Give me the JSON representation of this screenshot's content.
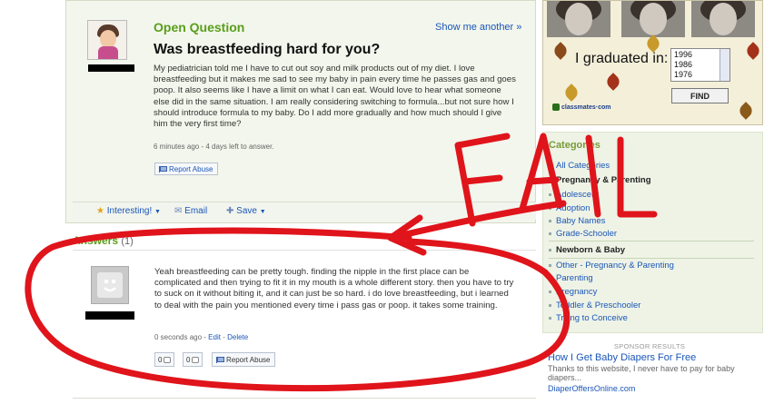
{
  "question": {
    "label": "Open Question",
    "show_another": "Show me another »",
    "title": "Was breastfeeding hard for you?",
    "body": "My pediatrician told me I have to cut out soy and milk products out of my diet. I love breastfeeding but it makes me sad to see my baby in pain every time he passes gas and goes poop. It also seems like I have a limit on what I can eat. Would love to hear what someone else did in the same situation. I am really considering switching to formula...but not sure how I should introduce formula to my baby. Do I add more gradually and how much should I give him the very first time?",
    "time": "6 minutes ago - 4 days left to answer.",
    "report_abuse": "Report Abuse"
  },
  "toolbar": {
    "interesting": "Interesting!",
    "email": "Email",
    "save": "Save"
  },
  "answers": {
    "heading": "Answers",
    "count": "(1)",
    "items": [
      {
        "body": "Yeah breastfeeding can be pretty tough. finding the nipple in the first place can be complicated and then trying to fit it in my mouth is a whole different story. then you have to try to suck on it without biting it, and it can just be so hard. i do love breastfeeding, but i learned to deal with the pain you mentioned every time i pass gas or poop. it takes some training.",
        "time": "0 seconds ago",
        "edit": "Edit",
        "delete": "Delete",
        "thumbs_up": "0",
        "thumbs_down": "0",
        "report_abuse": "Report Abuse"
      }
    ]
  },
  "ad": {
    "graduated_label": "I graduated in:",
    "years": [
      "1996",
      "1986",
      "1976"
    ],
    "find_button": "FIND",
    "brand": "classmates·com"
  },
  "categories": {
    "title": "Categories",
    "group1": [
      "All Categories",
      "Pregnancy & Parenting",
      "Adolescent",
      "Adoption",
      "Baby Names",
      "Grade-Schooler"
    ],
    "group2_title": "Newborn & Baby",
    "group2": [
      "Other - Pregnancy & Parenting",
      "Parenting",
      "Pregnancy",
      "Toddler & Preschooler",
      "Trying to Conceive"
    ]
  },
  "sponsor": {
    "label": "SPONSOR RESULTS",
    "title": "How I Get Baby Diapers For Free",
    "desc": "Thanks to this website, I never have to pay for baby diapers...",
    "url": "DiaperOffersOnline.com"
  },
  "overlay": {
    "text": "FAIL",
    "color": "#e0141b"
  },
  "colors": {
    "accent_green": "#5a9e1c",
    "link_blue": "#1a56b8"
  }
}
